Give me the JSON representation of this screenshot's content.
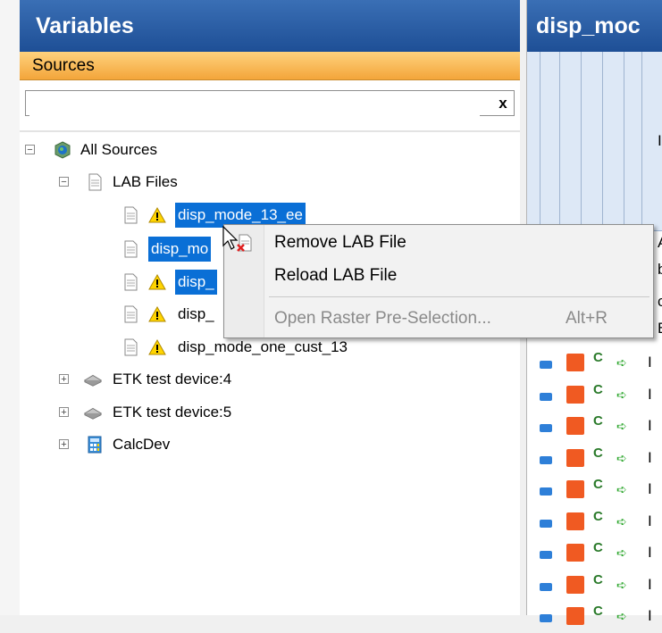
{
  "variables_panel": {
    "title": "Variables",
    "section": "Sources",
    "search": {
      "value": "",
      "clear_label": "x"
    }
  },
  "tree": {
    "root": {
      "label": "All Sources",
      "expander": "−"
    },
    "lab_files": {
      "label": "LAB Files",
      "expander": "−"
    },
    "files": [
      {
        "label": "disp_mode_13_ee",
        "warning": true,
        "selected": true
      },
      {
        "label": "disp_mo",
        "warning": false,
        "selected": true
      },
      {
        "label": "disp_",
        "warning": true,
        "selected": true
      },
      {
        "label": "disp_",
        "warning": true,
        "selected": false
      },
      {
        "label": "disp_mode_one_cust_13",
        "warning": true,
        "selected": false
      }
    ],
    "devices": [
      {
        "label": "ETK test device:4",
        "expander": "+"
      },
      {
        "label": "ETK test device:5",
        "expander": "+"
      },
      {
        "label": "CalcDev",
        "expander": "+"
      }
    ]
  },
  "right_panel": {
    "title": "disp_moc",
    "header_chars": [
      "I"
    ],
    "row_marker_letters": [
      "A",
      "b",
      "c",
      "B"
    ],
    "rows": 12
  },
  "context_menu": {
    "items": [
      {
        "label": "Remove LAB File",
        "shortcut": "",
        "enabled": true
      },
      {
        "label": "Reload LAB File",
        "shortcut": "",
        "enabled": true
      },
      {
        "label": "Open Raster Pre-Selection...",
        "shortcut": "Alt+R",
        "enabled": false
      }
    ]
  },
  "colors": {
    "header_blue": "#1e4f96",
    "section_orange": "#f3a53a",
    "selection_blue": "#0a6fd6",
    "warning_yellow": "#ffd400"
  }
}
